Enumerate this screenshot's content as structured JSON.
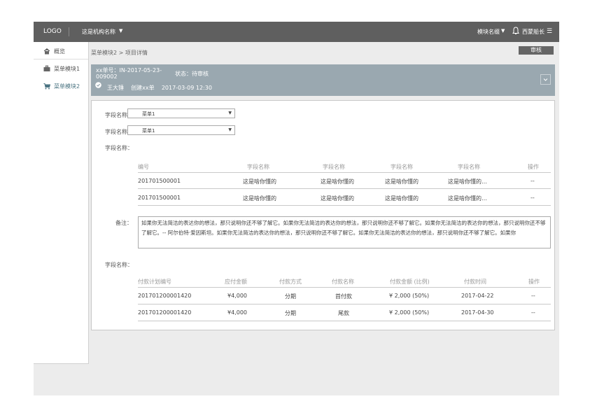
{
  "topbar": {
    "logo": "LOGO",
    "org_name": "这是机构名称",
    "module_name": "模块名缀",
    "user_name": "西蒙船长",
    "menu_icon": "hamburger-icon"
  },
  "sidebar": {
    "items": [
      {
        "label": "概览",
        "icon": "home-icon"
      },
      {
        "label": "菜单模块1",
        "icon": "briefcase-icon"
      },
      {
        "label": "菜单模块2",
        "icon": "cart-icon"
      }
    ]
  },
  "breadcrumb": "菜单模块2 > 项目详情",
  "review_button": "审核",
  "info": {
    "order_no": "xx单号：IN-2017-05-23-009002",
    "status": "状态：待审核",
    "creator": "王大锤",
    "created_text": "创建xx单",
    "created_time": "2017-03-09  12:30"
  },
  "form": {
    "field1_label": "字段名称：",
    "field1_value": "菜单1",
    "field2_label": "字段名称：",
    "field2_value": "菜单1",
    "field3_label": "字段名称：",
    "note_label": "备注：",
    "note_text": "如果你无法简洁的表达你的想法，那只说明你还不够了解它。如果你无法简洁的表达你的想法，那只说明你还不够了解它。如果你无法简洁的表达你的想法，那只说明你还不够了解它。-- 阿尔伯特·爱因斯坦。如果你无法简洁的表达你的想法，那只说明你还不够了解它。如果你无法简洁的表达你的想法，那只说明你还不够了解它。如果你",
    "field4_label": "字段名称："
  },
  "table1": {
    "headers": [
      "编号",
      "字段名称",
      "字段名称",
      "字段名称",
      "字段名称",
      "操作"
    ],
    "rows": [
      [
        "201701500001",
        "这是啥你懂的",
        "这是啥你懂的",
        "这是啥你懂的",
        "这是啥你懂的…",
        "--"
      ],
      [
        "201701500001",
        "这是啥你懂的",
        "这是啥你懂的",
        "这是啥你懂的",
        "这是啥你懂的…",
        "--"
      ]
    ]
  },
  "table2": {
    "headers": [
      "付款计划编号",
      "应付金额",
      "付款方式",
      "付款名称",
      "付款金额 (比例)",
      "付款时间",
      "操作"
    ],
    "rows": [
      [
        "201701200001420",
        "¥4,000",
        "分期",
        "首付款",
        "¥ 2,000  (50%)",
        "2017-04-22",
        "--"
      ],
      [
        "201701200001420",
        "¥4,000",
        "分期",
        "尾款",
        "¥ 2,000  (50%)",
        "2017-04-30",
        "--"
      ]
    ]
  }
}
